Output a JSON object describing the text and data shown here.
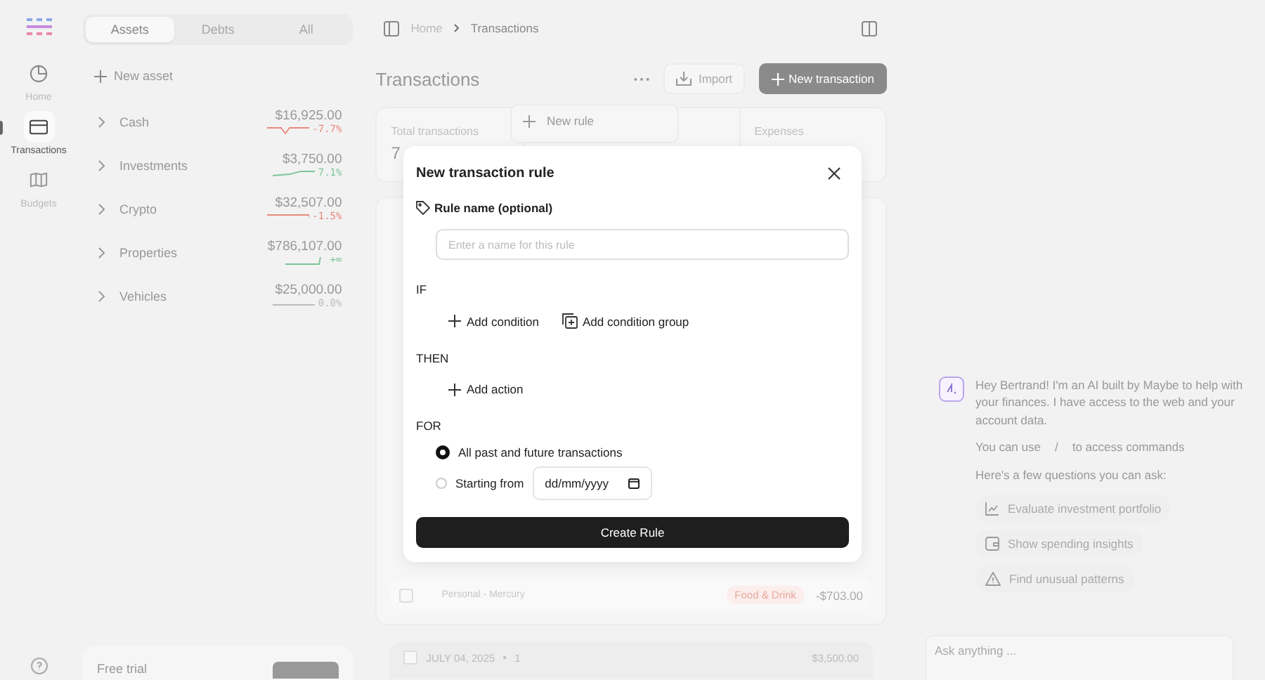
{
  "nav": {
    "items": [
      {
        "label": "Home",
        "selected": false,
        "kind": "home"
      },
      {
        "label": "Transactions",
        "selected": true,
        "kind": "card"
      },
      {
        "label": "Budgets",
        "selected": false,
        "kind": "map"
      }
    ]
  },
  "asset_tabs": [
    {
      "label": "Assets",
      "selected": true
    },
    {
      "label": "Debts",
      "selected": false
    },
    {
      "label": "All",
      "selected": false
    }
  ],
  "new_asset": "New asset",
  "accounts": [
    {
      "name": "Cash",
      "amount": "$16,925.00",
      "change": "-7.7%",
      "color": "#e8897d"
    },
    {
      "name": "Investments",
      "amount": "$3,750.00",
      "change": "7.1%",
      "color": "#7cc49a"
    },
    {
      "name": "Crypto",
      "amount": "$32,507.00",
      "change": "-1.5%",
      "color": "#e8897d"
    },
    {
      "name": "Properties",
      "amount": "$786,107.00",
      "change": "+∞",
      "color": "#7cc49a"
    },
    {
      "name": "Vehicles",
      "amount": "$25,000.00",
      "change": "0.0%",
      "color": "#bbbbbb"
    }
  ],
  "free_trial": "Free trial",
  "breadcrumb": [
    "Home",
    "Transactions"
  ],
  "page_title": "Transactions",
  "import": "Import",
  "new_transaction": "New transaction",
  "stats": [
    {
      "label": "Total transactions",
      "value": "7"
    },
    {
      "label": "Expenses"
    }
  ],
  "menu": {
    "items": [
      "New rule"
    ]
  },
  "transaction": {
    "checked": false,
    "account": "Personal - Mercury",
    "category": "Food & Drink",
    "amount": "-$703.00"
  },
  "date_group": {
    "checked": false,
    "date": "JULY 04, 2025",
    "count": "1",
    "total": "$3,500.00"
  },
  "dialog": {
    "title": "New transaction rule",
    "name_label": "Rule name (optional)",
    "name_placeholder": "Enter a name for this rule",
    "if_label": "IF",
    "conditions": [
      {
        "label": "Add condition",
        "kind": "plus"
      },
      {
        "label": "Add condition group",
        "kind": "group"
      }
    ],
    "then_label": "THEN",
    "actions": [
      {
        "label": "Add action",
        "kind": "plus"
      }
    ],
    "for_label": "FOR",
    "scope": [
      {
        "label": "All past and future transactions",
        "selected": true
      },
      {
        "label": "Starting from",
        "selected": false,
        "date_placeholder": "dd/mm/yyyy"
      }
    ],
    "submit": "Create Rule"
  },
  "chat": {
    "greeting": "Hey Bertrand! I'm an AI built by Maybe to help with your finances. I have access to the web and your account data.",
    "commands_pre": "You can use",
    "command_key": "/",
    "commands_post": "to access commands",
    "prompt": "Here's a few questions you can ask:",
    "suggestions": [
      {
        "label": "Evaluate investment portfolio",
        "kind": "chart"
      },
      {
        "label": "Show spending insights",
        "kind": "wallet"
      },
      {
        "label": "Find unusual patterns",
        "kind": "warning"
      }
    ],
    "input_placeholder": "Ask anything ..."
  }
}
